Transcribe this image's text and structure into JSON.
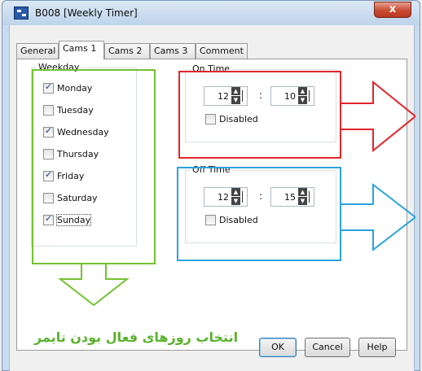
{
  "window": {
    "title": "B008 [Weekly Timer]",
    "close_label": "x"
  },
  "tabs": [
    {
      "label": "General",
      "active": false
    },
    {
      "label": "Cams 1",
      "active": true
    },
    {
      "label": "Cams 2",
      "active": false
    },
    {
      "label": "Cams 3",
      "active": false
    },
    {
      "label": "Comment",
      "active": false
    }
  ],
  "weekday": {
    "title": "Weekday",
    "days": [
      {
        "label": "Monday",
        "checked": true
      },
      {
        "label": "Tuesday",
        "checked": false
      },
      {
        "label": "Wednesday",
        "checked": true
      },
      {
        "label": "Thursday",
        "checked": false
      },
      {
        "label": "Friday",
        "checked": true
      },
      {
        "label": "Saturday",
        "checked": false
      },
      {
        "label": "Sunday",
        "checked": true
      }
    ]
  },
  "on_time": {
    "title": "On Time",
    "hour": "12",
    "minute": "10",
    "separator": ":",
    "disabled_label": "Disabled",
    "disabled_checked": false
  },
  "off_time": {
    "title": "Off Time",
    "hour": "12",
    "minute": "15",
    "separator": ":",
    "disabled_label": "Disabled",
    "disabled_checked": false
  },
  "annotation": {
    "text": "انتخاب روزهای فعال بودن تایمر",
    "red": "#e2262b",
    "blue": "#2aa3dc",
    "green": "#72c232"
  },
  "buttons": {
    "ok": "OK",
    "cancel": "Cancel",
    "help": "Help"
  }
}
